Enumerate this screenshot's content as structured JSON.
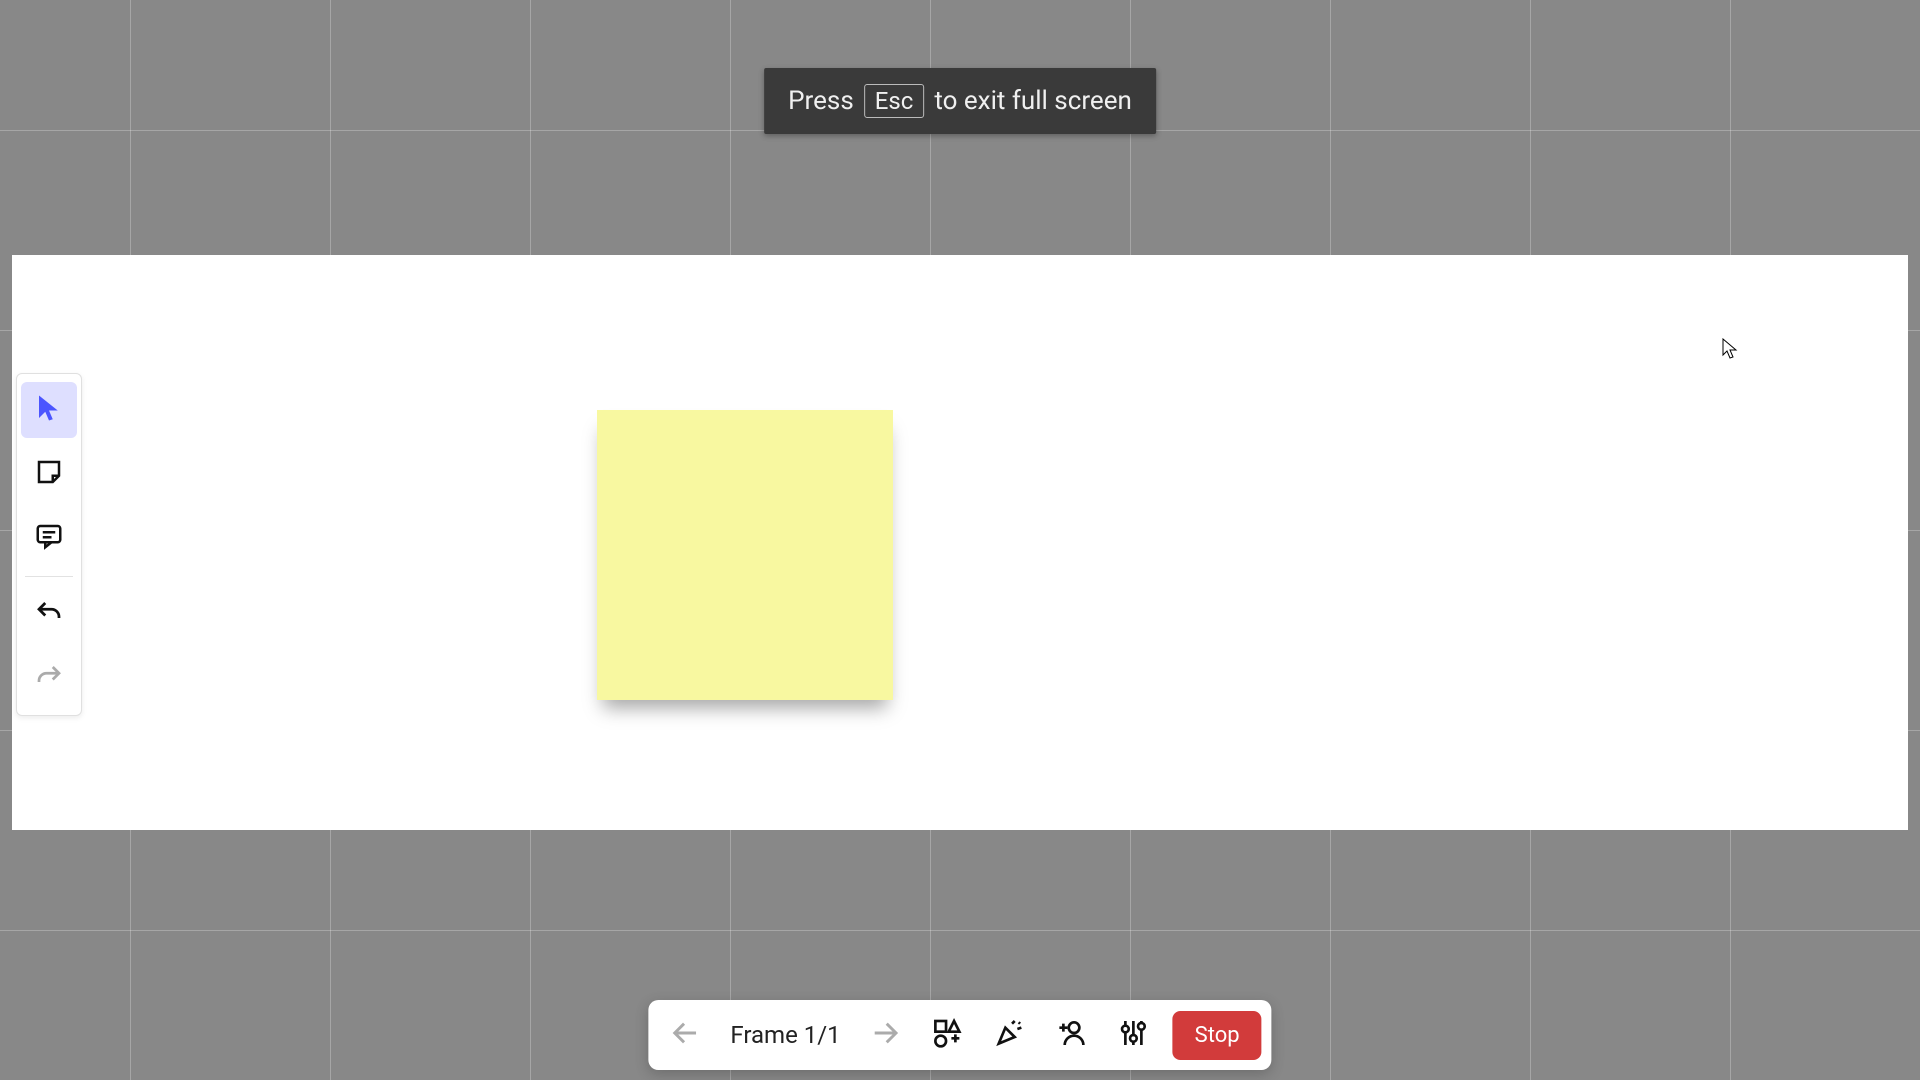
{
  "toast": {
    "before": "Press",
    "key": "Esc",
    "after": "to exit full screen"
  },
  "side_toolbar": {
    "select": "select",
    "note": "sticky note",
    "comment": "comment",
    "undo": "undo",
    "redo": "redo"
  },
  "canvas": {
    "sticky_note_color": "#f8f8a0"
  },
  "bottom_bar": {
    "prev": "previous frame",
    "frame_label": "Frame 1/1",
    "next": "next frame",
    "shapes": "shapes",
    "confetti": "reactions",
    "add_user": "add participant",
    "settings": "settings",
    "stop": "Stop"
  }
}
